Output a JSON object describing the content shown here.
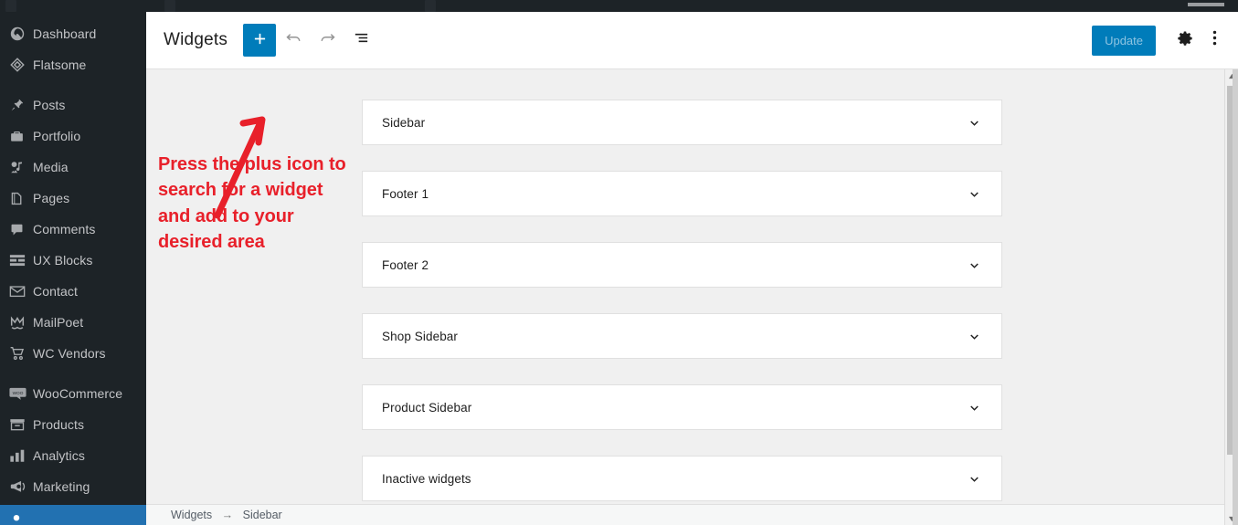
{
  "admin_bar": {
    "present": true
  },
  "sidebar": {
    "items": [
      {
        "label": "Dashboard",
        "icon": "dashboard-icon",
        "active": false
      },
      {
        "label": "Flatsome",
        "icon": "flatsome-icon",
        "active": false
      },
      {
        "label": "Posts",
        "icon": "pin-icon",
        "active": false
      },
      {
        "label": "Portfolio",
        "icon": "portfolio-icon",
        "active": false
      },
      {
        "label": "Media",
        "icon": "media-icon",
        "active": false
      },
      {
        "label": "Pages",
        "icon": "pages-icon",
        "active": false
      },
      {
        "label": "Comments",
        "icon": "comments-icon",
        "active": false
      },
      {
        "label": "UX Blocks",
        "icon": "ux-blocks-icon",
        "active": false
      },
      {
        "label": "Contact",
        "icon": "envelope-icon",
        "active": false
      },
      {
        "label": "MailPoet",
        "icon": "mailpoet-icon",
        "active": false
      },
      {
        "label": "WC Vendors",
        "icon": "cart-icon",
        "active": false
      },
      {
        "label": "WooCommerce",
        "icon": "woocommerce-icon",
        "active": false
      },
      {
        "label": "Products",
        "icon": "products-icon",
        "active": false
      },
      {
        "label": "Analytics",
        "icon": "analytics-icon",
        "active": false
      },
      {
        "label": "Marketing",
        "icon": "megaphone-icon",
        "active": false
      }
    ]
  },
  "toolbar": {
    "title": "Widgets",
    "add_label": "+",
    "add_icon": "plus-icon",
    "undo_icon": "undo-icon",
    "redo_icon": "redo-icon",
    "list_view_icon": "list-view-icon",
    "update_label": "Update",
    "update_disabled": true,
    "settings_icon": "gear-icon",
    "options_icon": "kebab-menu-icon",
    "accent_color": "#007cba"
  },
  "main": {
    "widget_areas": [
      {
        "name": "Sidebar",
        "chevron": "chevron-down-icon"
      },
      {
        "name": "Footer 1",
        "chevron": "chevron-down-icon"
      },
      {
        "name": "Footer 2",
        "chevron": "chevron-down-icon"
      },
      {
        "name": "Shop Sidebar",
        "chevron": "chevron-down-icon"
      },
      {
        "name": "Product Sidebar",
        "chevron": "chevron-down-icon"
      },
      {
        "name": "Inactive widgets",
        "chevron": "chevron-down-icon"
      }
    ]
  },
  "annotation": {
    "text": "Press the plus icon to search for a widget and add to your desired area",
    "color": "#e8202a",
    "arrow_icon": "arrow-up-right-icon"
  },
  "footer": {
    "breadcrumb": [
      "Widgets",
      "Sidebar"
    ],
    "separator": "→"
  },
  "scrollbar": {
    "up_icon": "triangle-up-icon",
    "down_icon": "triangle-down-icon"
  }
}
